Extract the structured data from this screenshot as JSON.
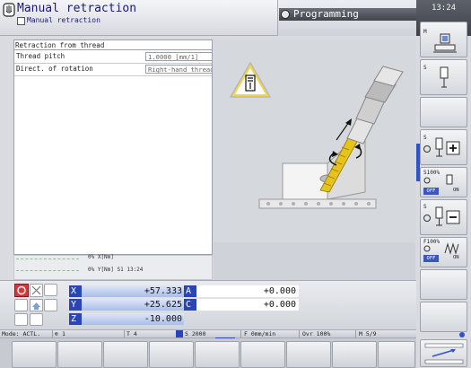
{
  "header": {
    "mode_title": "Manual retraction",
    "mode_subtitle": "Manual retraction",
    "programming_label": "Programming",
    "clock": "13:24"
  },
  "form": {
    "section_title": "Retraction from thread",
    "fields": [
      {
        "label": "Thread pitch",
        "value": "1.0000 [mm/1]"
      },
      {
        "label": "Direct. of rotation",
        "value": "Right-hand thread"
      }
    ]
  },
  "status": {
    "line1": "0% X[Nm]",
    "line2": "0% Y[Nm] S1  13:24"
  },
  "axes": [
    {
      "letter": "X",
      "value": "+57.333"
    },
    {
      "letter": "Y",
      "value": "+25.625"
    },
    {
      "letter": "Z",
      "value": "-10.000"
    }
  ],
  "axes2": [
    {
      "letter": "A",
      "value": "+0.000"
    },
    {
      "letter": "C",
      "value": "+0.000"
    }
  ],
  "infobar": {
    "mode": "Mode: ACTL.",
    "tool_number": "1",
    "tool": "T 4",
    "spindle": "S 2000",
    "feed": "F 0mm/min",
    "override": "Ovr 100%",
    "mfunc": "M 5/9"
  },
  "right_softkeys": {
    "m_label": "M",
    "s_label": "S",
    "s100": "S100%",
    "f100": "F100%",
    "off1": "OFF",
    "on1": "ON",
    "off2": "OFF",
    "on2": "ON"
  },
  "colors": {
    "axis_letter_bg": "#2a45b8",
    "axis_field_bg": "#a9bde8",
    "accent_blue": "#2f54c8",
    "tool_yellow": "#e6c21a"
  }
}
